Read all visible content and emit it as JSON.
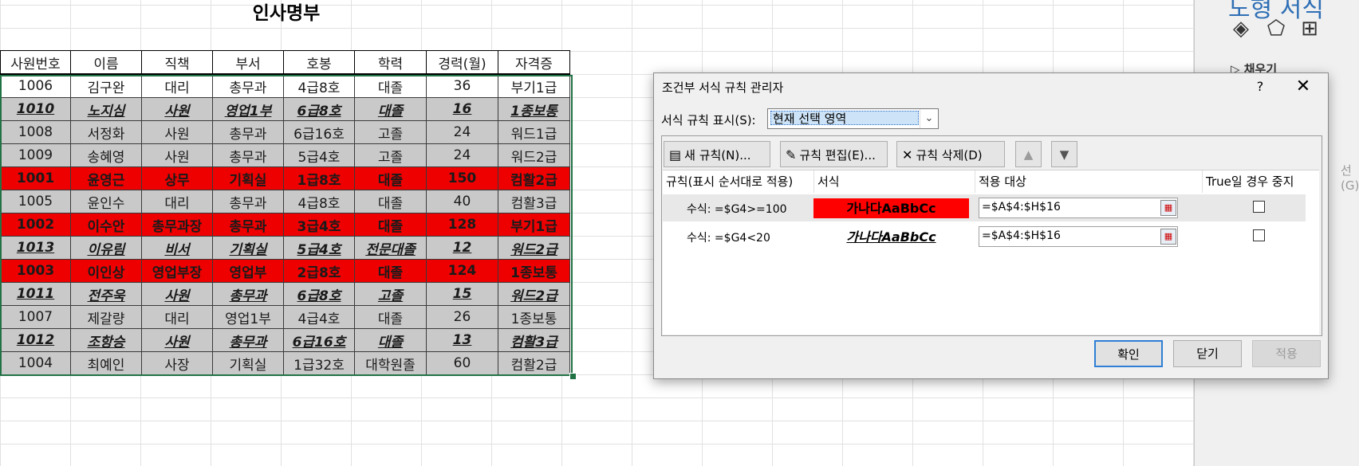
{
  "sheet": {
    "title": "인사명부",
    "columns": [
      88,
      89,
      89,
      89,
      89,
      90,
      90,
      90
    ],
    "header": [
      "사원번호",
      "이름",
      "직책",
      "부서",
      "호봉",
      "학력",
      "경력(월)",
      "자격증"
    ],
    "rows": [
      {
        "style": "normal",
        "cells": [
          "1006",
          "김구완",
          "대리",
          "총무과",
          "4급8호",
          "대졸",
          "36",
          "부기1급"
        ]
      },
      {
        "style": "bold-u",
        "cells": [
          "1010",
          "노지심",
          "사원",
          "영업1부",
          "6급8호",
          "대졸",
          "16",
          "1종보통"
        ]
      },
      {
        "style": "normal",
        "cells": [
          "1008",
          "서정화",
          "사원",
          "총무과",
          "6급16호",
          "고졸",
          "24",
          "워드1급"
        ]
      },
      {
        "style": "normal",
        "cells": [
          "1009",
          "송혜영",
          "사원",
          "총무과",
          "5급4호",
          "고졸",
          "24",
          "워드2급"
        ]
      },
      {
        "style": "red",
        "cells": [
          "1001",
          "윤영근",
          "상무",
          "기획실",
          "1급8호",
          "대졸",
          "150",
          "컴활2급"
        ]
      },
      {
        "style": "normal",
        "cells": [
          "1005",
          "윤인수",
          "대리",
          "총무과",
          "4급8호",
          "대졸",
          "40",
          "컴활3급"
        ]
      },
      {
        "style": "red",
        "cells": [
          "1002",
          "이수안",
          "총무과장",
          "총무과",
          "3급4호",
          "대졸",
          "128",
          "부기1급"
        ]
      },
      {
        "style": "bold-u",
        "cells": [
          "1013",
          "이유림",
          "비서",
          "기획실",
          "5급4호",
          "전문대졸",
          "12",
          "워드2급"
        ]
      },
      {
        "style": "red",
        "cells": [
          "1003",
          "이인상",
          "영업부장",
          "영업부",
          "2급8호",
          "대졸",
          "124",
          "1종보통"
        ]
      },
      {
        "style": "bold-u",
        "cells": [
          "1011",
          "전주욱",
          "사원",
          "총무과",
          "6급8호",
          "고졸",
          "15",
          "워드2급"
        ]
      },
      {
        "style": "normal",
        "cells": [
          "1007",
          "제갈량",
          "대리",
          "영업1부",
          "4급4호",
          "대졸",
          "26",
          "1종보통"
        ]
      },
      {
        "style": "bold-u",
        "cells": [
          "1012",
          "조항승",
          "사원",
          "총무과",
          "6급16호",
          "대졸",
          "13",
          "컴활3급"
        ]
      },
      {
        "style": "normal",
        "cells": [
          "1004",
          "최예인",
          "사장",
          "기획실",
          "1급32호",
          "대학원졸",
          "60",
          "컴활2급"
        ]
      }
    ]
  },
  "pane": {
    "title": "도형 서식",
    "icons": [
      "fill-line-icon",
      "effects-icon",
      "size-properties-icon"
    ],
    "fill_label": "▷ 채우기",
    "right_text": "선(G)"
  },
  "dialog": {
    "title": "조건부 서식 규칙 관리자",
    "help": "?",
    "close": "✕",
    "show_label": "서식 규칙 표시(S):",
    "show_value": "현재 선택 영역",
    "toolbar": {
      "new_rule": "새 규칙(N)...",
      "edit_rule": "규칙 편집(E)...",
      "delete_rule": "규칙 삭제(D)",
      "move_up": "▲",
      "move_down": "▼"
    },
    "table_header": {
      "rule": "규칙(표시 순서대로 적용)",
      "format": "서식",
      "applies_to": "적용 대상",
      "stop_if_true": "True일 경우 중지"
    },
    "rules": [
      {
        "formula": "수식: =$G4>=100",
        "preview": "가나다AaBbCc",
        "preview_bg": "#ff0000",
        "range": "=$A$4:$H$16",
        "stop": false
      },
      {
        "formula": "수식: =$G4<20",
        "preview": "가나다AaBbCc",
        "preview_bg": "#ffffff",
        "range": "=$A$4:$H$16",
        "stop": false
      }
    ],
    "buttons": {
      "ok": "확인",
      "close": "닫기",
      "apply": "적용"
    }
  }
}
